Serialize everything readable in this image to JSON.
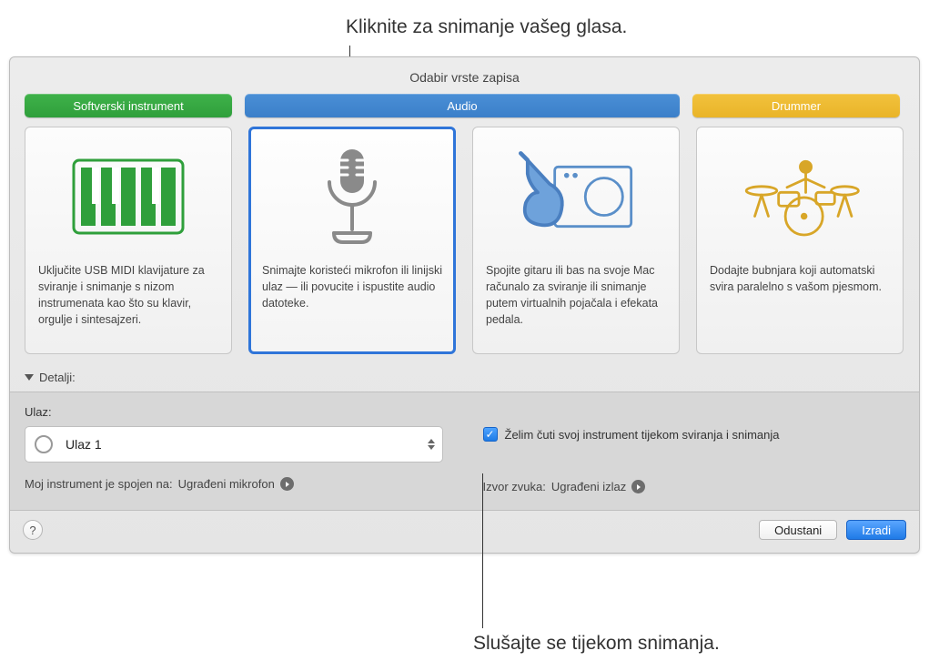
{
  "callouts": {
    "top": "Kliknite za snimanje vašeg glasa.",
    "bottom": "Slušajte se tijekom snimanja."
  },
  "dialog": {
    "title": "Odabir vrste zapisa",
    "tabs": {
      "software_instrument": "Softverski instrument",
      "audio": "Audio",
      "drummer": "Drummer"
    },
    "cards": {
      "software_instrument": "Uključite USB MIDI klavijature za sviranje i snimanje s nizom instrumenata kao što su klavir, orgulje i sintesajzeri.",
      "audio_mic": "Snimajte koristeći mikrofon ili linijski ulaz — ili povucite i ispustite audio datoteke.",
      "audio_guitar": "Spojite gitaru ili bas na svoje Mac računalo za sviranje ili snimanje putem virtualnih pojačala i efekata pedala.",
      "drummer": "Dodajte bubnjara koji automatski svira paralelno s vašom pjesmom."
    },
    "details_label": "Detalji:",
    "input": {
      "label": "Ulaz:",
      "value": "Ulaz 1",
      "connection_prefix": "Moj instrument je spojen na: ",
      "connection_value": "Ugrađeni mikrofon"
    },
    "monitoring": {
      "checkbox_label": "Želim čuti svoj instrument tijekom sviranja i snimanja",
      "sound_source_prefix": "Izvor zvuka: ",
      "sound_source_value": "Ugrađeni izlaz"
    },
    "buttons": {
      "help": "?",
      "cancel": "Odustani",
      "create": "Izradi"
    }
  },
  "colors": {
    "green": "#34a744",
    "blue": "#3f84d0",
    "yellow": "#edb931",
    "selection": "#2f75d9"
  }
}
